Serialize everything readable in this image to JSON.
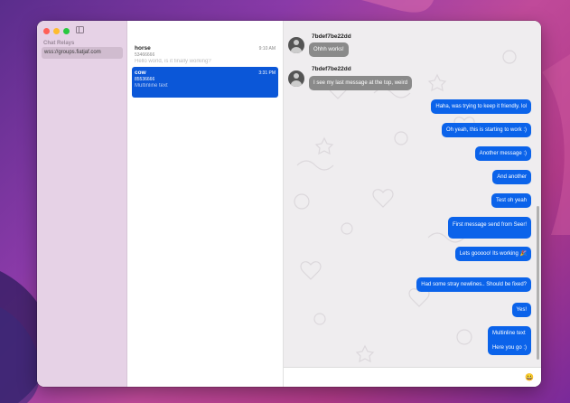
{
  "sidebar": {
    "heading": "Chat Relays",
    "relays": [
      "wss://groups.fiatjaf.com"
    ]
  },
  "conversations": [
    {
      "name": "horse",
      "time": "9:10 AM",
      "id": "53466666",
      "preview": "Hello world, is it finally working?",
      "selected": false
    },
    {
      "name": "cow",
      "time": "3:31 PM",
      "id": "85536666",
      "preview": "Multinline text",
      "selected": true
    }
  ],
  "chat": {
    "incoming": [
      {
        "sender": "7bdef7be22dd",
        "text": "Ohhh works!"
      },
      {
        "sender": "7bdef7be22dd",
        "text": "I see my last message at the top, weird"
      }
    ],
    "outgoing": [
      "Haha, was trying to keep it friendly. lol",
      "Oh yeah, this is starting to work :)",
      "Another message :)",
      "And another",
      "Test oh yeah",
      "First message send from Seer!",
      "Lets gooooo! Its working 🎉",
      "Had some stray newlines.. Should be fixed?",
      "Yes!",
      "Multinline text",
      "Here you go :)"
    ],
    "emoji_icon": "😀"
  },
  "colors": {
    "accent": "#0b57d8",
    "outgoing_bubble": "#0b63ea",
    "incoming_bubble": "#8a8a8a",
    "sidebar_bg": "#e6d2e6"
  }
}
